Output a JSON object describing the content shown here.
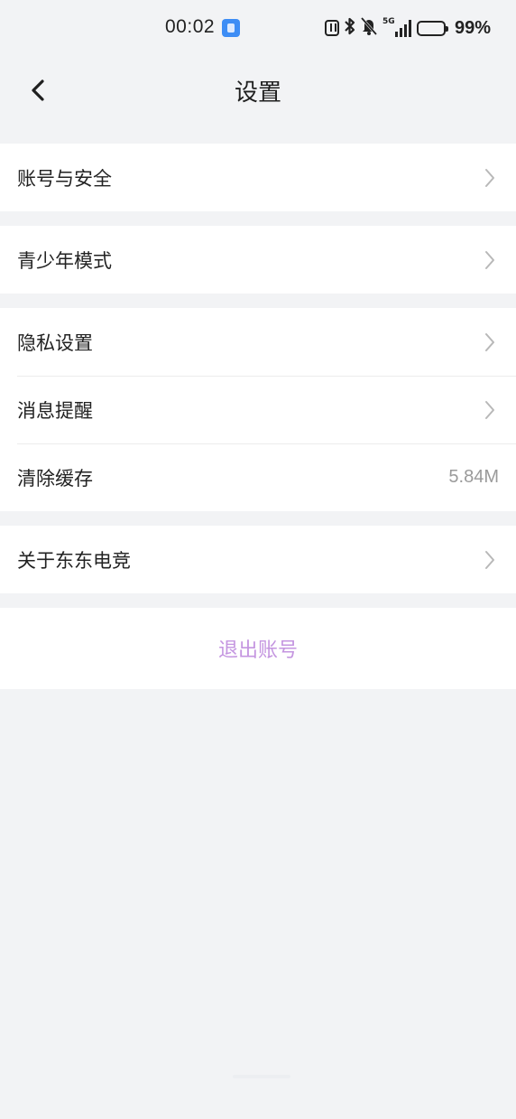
{
  "status_bar": {
    "time": "00:02",
    "battery": "99%"
  },
  "header": {
    "title": "设置"
  },
  "groups": [
    {
      "items": [
        {
          "label": "账号与安全"
        }
      ]
    },
    {
      "items": [
        {
          "label": "青少年模式"
        }
      ]
    },
    {
      "items": [
        {
          "label": "隐私设置"
        },
        {
          "label": "消息提醒"
        },
        {
          "label": "清除缓存",
          "value": "5.84M"
        }
      ]
    },
    {
      "items": [
        {
          "label": "关于东东电竞"
        }
      ]
    }
  ],
  "logout": {
    "label": "退出账号"
  },
  "colors": {
    "background": "#f2f3f5",
    "card": "#ffffff",
    "logout_text": "#c495e0",
    "secondary_text": "#9a9a9a"
  },
  "icons": [
    "back-icon",
    "chevron-right-icon",
    "nfc-icon",
    "bluetooth-icon",
    "mute-icon",
    "signal-icon",
    "battery-icon"
  ]
}
